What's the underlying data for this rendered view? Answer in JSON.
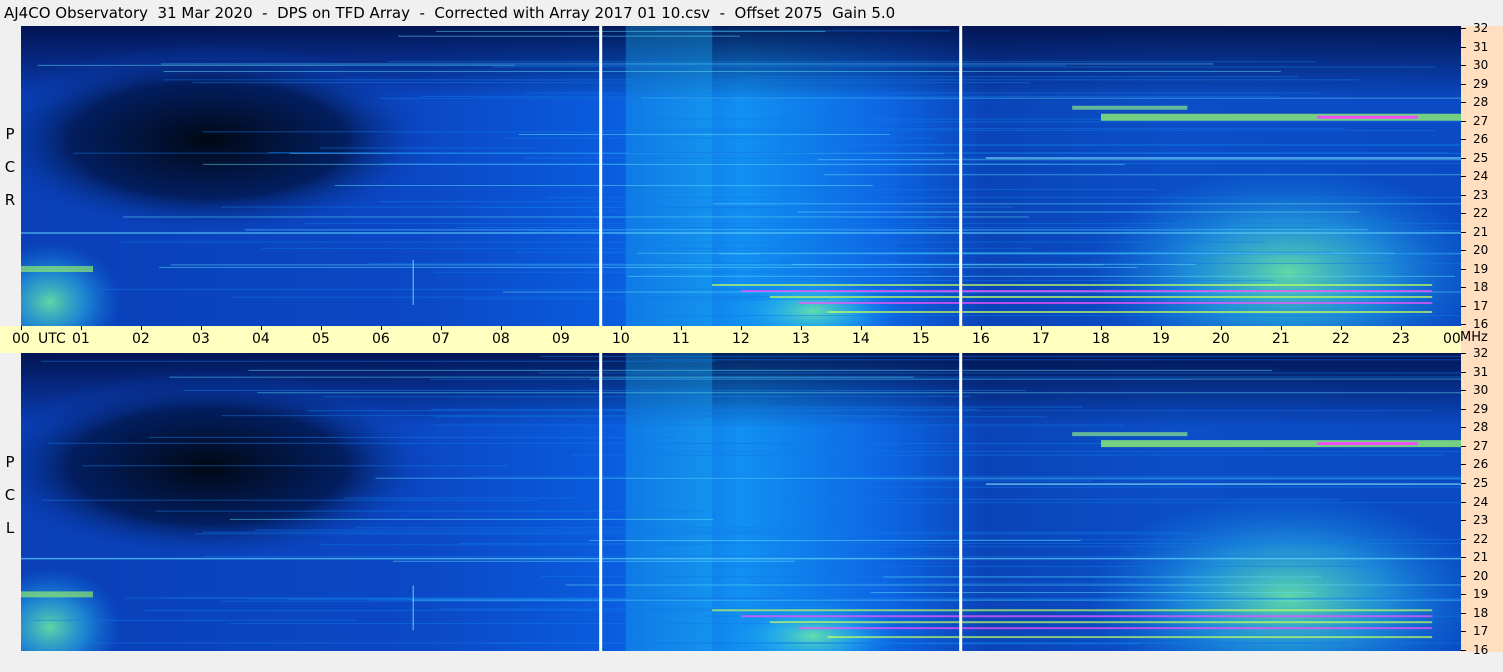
{
  "title": "AJ4CO Observatory  31 Mar 2020  -  DPS on TFD Array  -  Corrected with Array 2017 01 10.csv  -  Offset 2075  Gain 5.0",
  "panels": {
    "top": {
      "polarization_letters": [
        "P",
        "C",
        "R"
      ]
    },
    "bottom": {
      "polarization_letters": [
        "P",
        "C",
        "L"
      ]
    }
  },
  "time_axis": {
    "labels": [
      "00",
      "01",
      "02",
      "03",
      "04",
      "05",
      "06",
      "07",
      "08",
      "09",
      "10",
      "11",
      "12",
      "13",
      "14",
      "15",
      "16",
      "17",
      "18",
      "19",
      "20",
      "21",
      "22",
      "23",
      "00"
    ],
    "utc_label": "UTC",
    "mhz_label": "MHz"
  },
  "freq_axis": {
    "labels": [
      "32",
      "31",
      "30",
      "29",
      "28",
      "27",
      "26",
      "25",
      "24",
      "23",
      "22",
      "21",
      "20",
      "19",
      "18",
      "17",
      "16"
    ]
  },
  "colors": {
    "background": "#f0f0f0",
    "time_bar": "#ffffc0",
    "freq_scale": "#ffdfc0",
    "spectrogram_low": "#000814",
    "spectrogram_mid": "#0a5ce0",
    "spectrogram_high": "#a0ff60",
    "spectrogram_peak": "#ff40ff"
  },
  "chart_data": {
    "type": "heatmap",
    "title": "AJ4CO Observatory  31 Mar 2020  -  DPS on TFD Array  -  Corrected with Array 2017 01 10.csv  -  Offset 2075  Gain 5.0",
    "xlabel": "UTC",
    "ylabel": "MHz",
    "x_range": [
      0,
      24
    ],
    "y_range": [
      16,
      32
    ],
    "series": [
      {
        "name": "RCP"
      },
      {
        "name": "LCP"
      }
    ],
    "file_boundaries_utc": [
      9.67,
      15.67
    ]
  }
}
